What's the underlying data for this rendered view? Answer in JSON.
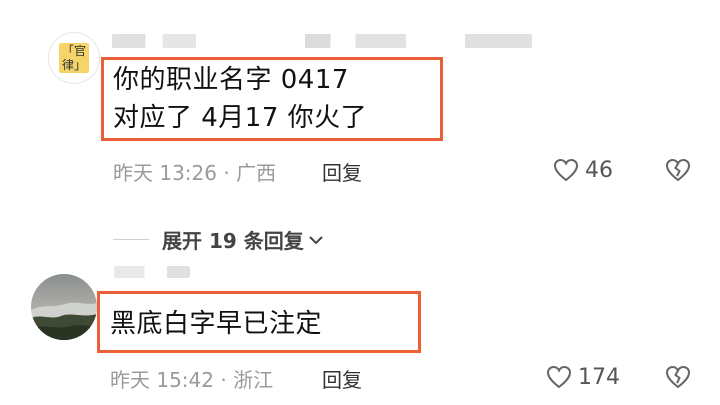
{
  "comments": [
    {
      "avatar_text": "「官\n律」",
      "text_lines": [
        "你的职业名字 0417",
        "对应了 4月17 你火了"
      ],
      "time": "昨天 13:26",
      "location": "广西",
      "reply_label": "回复",
      "likes": "46"
    },
    {
      "text_lines": [
        "黑底白字早已注定"
      ],
      "time": "昨天 15:42",
      "location": "浙江",
      "reply_label": "回复",
      "likes": "174"
    }
  ],
  "expand_replies": {
    "label": "展开 19 条回复"
  },
  "colors": {
    "highlight": "#ec5f37",
    "meta": "#9a9a9a",
    "text": "#111111"
  },
  "icons": {
    "like": "heart-outline-icon",
    "dislike": "broken-heart-icon",
    "expand": "chevron-down-icon"
  }
}
